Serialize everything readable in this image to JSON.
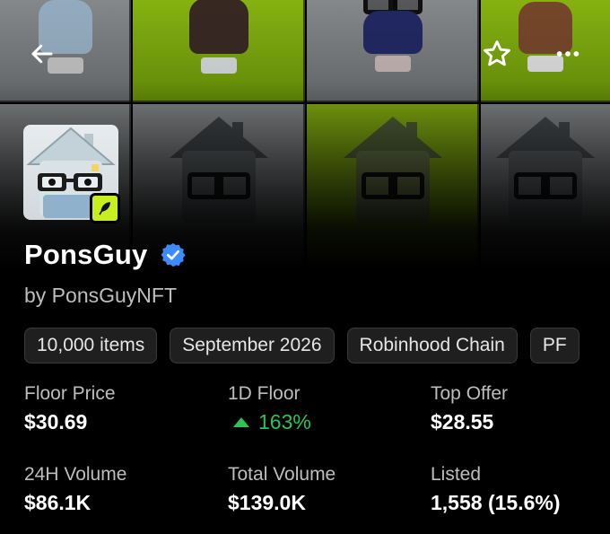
{
  "collection": {
    "name": "PonsGuy",
    "creator": "by PonsGuyNFT"
  },
  "header": {
    "back_icon": "arrow-left-icon",
    "favorite_icon": "star-outline-icon",
    "more_icon": "more-horizontal-icon"
  },
  "tags": [
    "10,000 items",
    "September 2026",
    "Robinhood Chain",
    "PF"
  ],
  "stats": {
    "floor_price": {
      "label": "Floor Price",
      "value": "$30.69"
    },
    "floor_1d": {
      "label": "1D Floor",
      "value": "163%",
      "trend": "up",
      "color": "#2ec44f"
    },
    "top_offer": {
      "label": "Top Offer",
      "value": "$28.55"
    },
    "volume_24h": {
      "label": "24H Volume",
      "value": "$86.1K"
    },
    "total_volume": {
      "label": "Total Volume",
      "value": "$139.0K"
    },
    "listed": {
      "label": "Listed",
      "value": "1,558 (15.6%)"
    }
  },
  "colors": {
    "verified_blue": "#3d8bfd",
    "lime_accent": "#c7ee1e",
    "positive_green": "#2ec44f"
  }
}
